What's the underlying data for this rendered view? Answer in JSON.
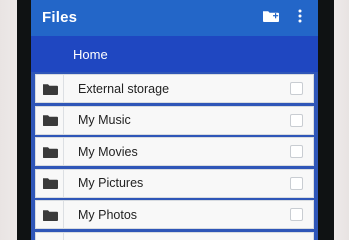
{
  "app": {
    "title": "Files"
  },
  "toolbar": {
    "new_folder_icon": "create-new-folder-icon",
    "more_icon": "more-vert-icon"
  },
  "breadcrumb": {
    "label": "Home"
  },
  "list": {
    "items": [
      {
        "label": "External storage",
        "icon": "folder-icon",
        "checked": false
      },
      {
        "label": "My Music",
        "icon": "folder-icon",
        "checked": false
      },
      {
        "label": "My Movies",
        "icon": "folder-icon",
        "checked": false
      },
      {
        "label": "My Pictures",
        "icon": "folder-icon",
        "checked": false
      },
      {
        "label": "My Photos",
        "icon": "folder-icon",
        "checked": false
      }
    ]
  },
  "colors": {
    "appbar": "#2366c8",
    "breadcrumb_bar": "#1f47c1",
    "screen_background": "#2f56b8",
    "row_background": "#f8f8f8",
    "icon": "#3a3a3a",
    "text": "#222222"
  }
}
